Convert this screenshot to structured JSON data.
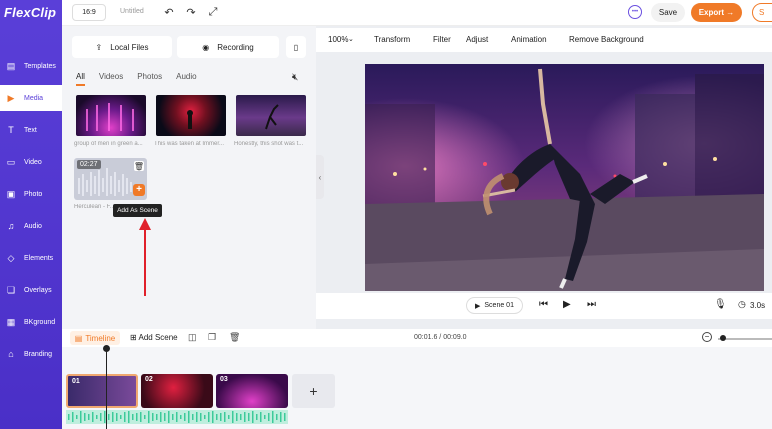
{
  "app": {
    "logo": "FlexClip"
  },
  "sidebar": {
    "items": [
      {
        "label": "Templates",
        "icon": "templates-icon"
      },
      {
        "label": "Media",
        "icon": "media-icon",
        "active": true
      },
      {
        "label": "Text",
        "icon": "text-icon"
      },
      {
        "label": "Video",
        "icon": "video-icon"
      },
      {
        "label": "Photo",
        "icon": "photo-icon"
      },
      {
        "label": "Audio",
        "icon": "audio-icon"
      },
      {
        "label": "Elements",
        "icon": "elements-icon"
      },
      {
        "label": "Overlays",
        "icon": "overlays-icon"
      },
      {
        "label": "BKground",
        "icon": "background-icon"
      },
      {
        "label": "Branding",
        "icon": "branding-icon"
      }
    ]
  },
  "topbar": {
    "ratio": "16:9",
    "title": "Untitled",
    "save": "Save",
    "export": "Export →",
    "upgrade": "S"
  },
  "panel": {
    "local_files": "Local Files",
    "recording": "Recording",
    "filters": [
      "All",
      "Videos",
      "Photos",
      "Audio"
    ],
    "media": [
      {
        "caption": "group of men in green a..."
      },
      {
        "caption": "This was taken at Immer..."
      },
      {
        "caption": "Honestly, this shot was t..."
      }
    ],
    "audio_item": {
      "duration": "02:27",
      "caption": "Herculean - F..."
    },
    "tooltip": "Add As Scene"
  },
  "tools": {
    "zoom": "100%",
    "items": [
      "Transform",
      "Filter",
      "Adjust",
      "Animation",
      "Remove Background"
    ]
  },
  "playbar": {
    "scene": "Scene 01",
    "duration": "3.0s"
  },
  "timeline": {
    "tab": "Timeline",
    "add_scene": "Add Scene",
    "time": "00:01.6 / 00:09.0",
    "clips": [
      "01",
      "02",
      "03"
    ],
    "add_clip": "+"
  },
  "colors": {
    "accent": "#f07a28",
    "brand": "#5a3fd8"
  }
}
